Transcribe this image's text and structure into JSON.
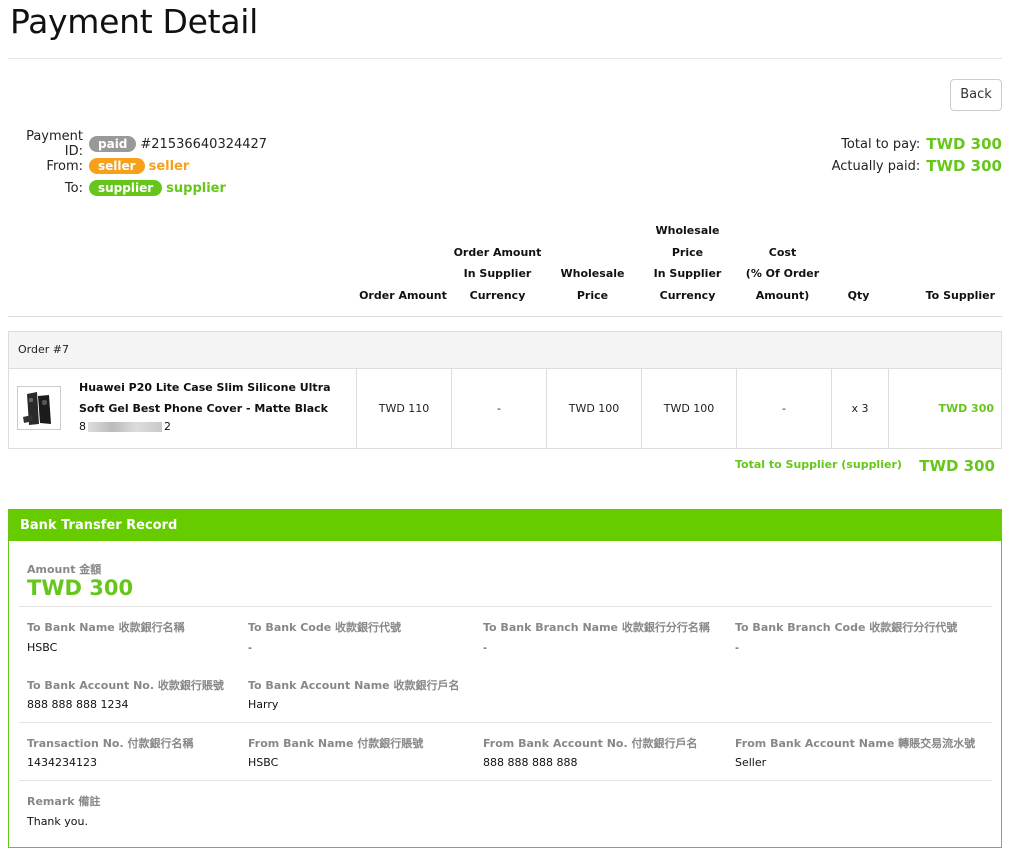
{
  "page": {
    "title": "Payment Detail",
    "back_label": "Back"
  },
  "payment": {
    "id_label": "Payment ID:",
    "status_badge": "paid",
    "id_value": "#21536640324427",
    "from_label": "From:",
    "from_badge": "seller",
    "from_name": "seller",
    "to_label": "To:",
    "to_badge": "supplier",
    "to_name": "supplier",
    "total_label": "Total to pay:",
    "total_value": "TWD 300",
    "paid_label": "Actually paid:",
    "paid_value": "TWD 300"
  },
  "table": {
    "headers": {
      "order_amount": "Order Amount",
      "order_amount_sc": [
        "Order Amount",
        "In Supplier",
        "Currency"
      ],
      "wholesale": [
        "Wholesale",
        "Price"
      ],
      "wholesale_sc": [
        "Wholesale",
        "Price",
        "In Supplier",
        "Currency"
      ],
      "cost": [
        "Cost",
        "(% Of Order",
        "Amount)"
      ],
      "qty": "Qty",
      "to_supplier": "To Supplier"
    },
    "order": {
      "label": "Order #7",
      "product_name": "Huawei P20 Lite Case Slim Silicone Ultra Soft Gel Best Phone Cover - Matte Black",
      "sku_start": "8",
      "sku_end": "2",
      "order_amount": "TWD 110",
      "order_amount_sc": "-",
      "wholesale": "TWD 100",
      "wholesale_sc": "TWD 100",
      "cost": "-",
      "qty": "x 3",
      "to_supplier": "TWD 300"
    },
    "total_supplier_label": "Total to Supplier (supplier)",
    "total_supplier_value": "TWD 300"
  },
  "bank": {
    "title": "Bank Transfer Record",
    "amount_label": "Amount 金額",
    "amount_value": "TWD 300",
    "fields": {
      "to_bank_name": {
        "label": "To Bank Name 收款銀行名稱",
        "value": "HSBC"
      },
      "to_bank_code": {
        "label": "To Bank Code 收款銀行代號",
        "value": "-"
      },
      "to_branch_name": {
        "label": "To Bank Branch Name 收款銀行分行名稱",
        "value": "-"
      },
      "to_branch_code": {
        "label": "To Bank Branch Code 收款銀行分行代號",
        "value": "-"
      },
      "to_account_no": {
        "label": "To Bank Account No. 收款銀行賬號",
        "value": "888 888 888 1234"
      },
      "to_account_name": {
        "label": "To Bank Account Name 收款銀行戶名",
        "value": "Harry"
      },
      "transaction_no": {
        "label": "Transaction No. 付款銀行名稱",
        "value": "1434234123"
      },
      "from_bank_name": {
        "label": "From Bank Name 付款銀行賬號",
        "value": "HSBC"
      },
      "from_account_no": {
        "label": "From Bank Account No. 付款銀行戶名",
        "value": "888 888 888 888"
      },
      "from_account_name": {
        "label": "From Bank Account Name 轉賬交易流水號",
        "value": "Seller"
      },
      "remark": {
        "label": "Remark 備註",
        "value": "Thank you."
      }
    }
  },
  "colors": {
    "accent_green": "#66c61c",
    "header_green": "#66cc00",
    "seller_orange": "#f7a11a",
    "paid_gray": "#999999"
  }
}
